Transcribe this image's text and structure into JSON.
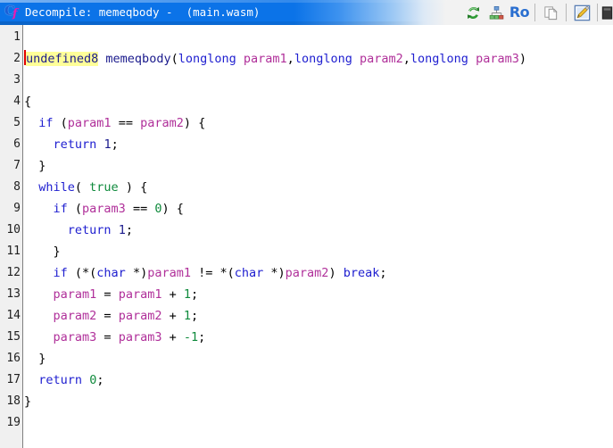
{
  "window": {
    "title": "Decompile: memeqbody -  (main.wasm)",
    "app_icon_letter": "C",
    "app_icon_sub": "f"
  },
  "toolbar": {
    "items": [
      {
        "name": "refresh-decompile-icon",
        "label": ""
      },
      {
        "name": "function-graph-icon",
        "label": ""
      },
      {
        "name": "ro-toggle-icon",
        "label": "Ro"
      },
      {
        "name": "copy-icon",
        "label": ""
      },
      {
        "name": "edit-icon",
        "label": ""
      },
      {
        "name": "overflow-icon",
        "label": ""
      }
    ],
    "ro_label": "Ro"
  },
  "editor": {
    "line_numbers": [
      "1",
      "2",
      "3",
      "4",
      "5",
      "6",
      "7",
      "8",
      "9",
      "10",
      "11",
      "12",
      "13",
      "14",
      "15",
      "16",
      "17",
      "18",
      "19"
    ],
    "highlighted_token": "undefined8",
    "caret_line": 2,
    "lines": [
      {
        "num": "1",
        "text": ""
      },
      {
        "num": "2",
        "text": "undefined8 memeqbody(longlong param1,longlong param2,longlong param3)"
      },
      {
        "num": "3",
        "text": ""
      },
      {
        "num": "4",
        "text": "{"
      },
      {
        "num": "5",
        "text": "  if (param1 == param2) {"
      },
      {
        "num": "6",
        "text": "    return 1;"
      },
      {
        "num": "7",
        "text": "  }"
      },
      {
        "num": "8",
        "text": "  while( true ) {"
      },
      {
        "num": "9",
        "text": "    if (param3 == 0) {"
      },
      {
        "num": "10",
        "text": "      return 1;"
      },
      {
        "num": "11",
        "text": "    }"
      },
      {
        "num": "12",
        "text": "    if (*(char *)param1 != *(char *)param2) break;"
      },
      {
        "num": "13",
        "text": "    param1 = param1 + 1;"
      },
      {
        "num": "14",
        "text": "    param2 = param2 + 1;"
      },
      {
        "num": "15",
        "text": "    param3 = param3 + -1;"
      },
      {
        "num": "16",
        "text": "  }"
      },
      {
        "num": "17",
        "text": "  return 0;"
      },
      {
        "num": "18",
        "text": "}"
      },
      {
        "num": "19",
        "text": ""
      }
    ],
    "tokens": {
      "l2_type": "undefined8",
      "l2_space1": " ",
      "l2_fn": "memeqbody",
      "l2_open": "(",
      "l2_t1": "longlong",
      "l2_p1": "param1",
      "l2_comma1": ",",
      "l2_t2": "longlong",
      "l2_p2": "param2",
      "l2_comma2": ",",
      "l2_t3": "longlong",
      "l2_p3": "param3",
      "l2_close": ")",
      "l4_brace": "{",
      "l5_indent": "  ",
      "l5_if": "if",
      "l5_open": " (",
      "l5_p1": "param1",
      "l5_eq": " == ",
      "l5_p2": "param2",
      "l5_close": ") {",
      "l6_indent": "    ",
      "l6_return": "return",
      "l6_sp": " ",
      "l6_one": "1",
      "l6_semi": ";",
      "l7": "  }",
      "l8_indent": "  ",
      "l8_while": "while",
      "l8_open": "( ",
      "l8_true": "true",
      "l8_close": " ) {",
      "l9_indent": "    ",
      "l9_if": "if",
      "l9_open": " (",
      "l9_p3": "param3",
      "l9_eq": " == ",
      "l9_zero": "0",
      "l9_close": ") {",
      "l10_indent": "      ",
      "l10_return": "return",
      "l10_sp": " ",
      "l10_one": "1",
      "l10_semi": ";",
      "l11": "    }",
      "l12_indent": "    ",
      "l12_if": "if",
      "l12_a": " (*(",
      "l12_char1": "char",
      "l12_b": " *)",
      "l12_p1": "param1",
      "l12_ne": " != ",
      "l12_c": "*(",
      "l12_char2": "char",
      "l12_d": " *)",
      "l12_p2": "param2",
      "l12_e": ") ",
      "l12_break": "break",
      "l12_semi": ";",
      "l13_indent": "    ",
      "l13_p1": "param1",
      "l13_assign": " = ",
      "l13_p1b": "param1",
      "l13_plus": " + ",
      "l13_one": "1",
      "l13_semi": ";",
      "l14_indent": "    ",
      "l14_p2": "param2",
      "l14_assign": " = ",
      "l14_p2b": "param2",
      "l14_plus": " + ",
      "l14_one": "1",
      "l14_semi": ";",
      "l15_indent": "    ",
      "l15_p3": "param3",
      "l15_assign": " = ",
      "l15_p3b": "param3",
      "l15_plus": " + ",
      "l15_negone": "-1",
      "l15_semi": ";",
      "l16": "  }",
      "l17_indent": "  ",
      "l17_return": "return",
      "l17_sp": " ",
      "l17_zero": "0",
      "l17_semi": ";",
      "l18_brace": "}"
    }
  },
  "colors": {
    "titlebar_blue": "#0b73e8",
    "gutter_bg": "#f0f0f0",
    "highlight_yellow": "#ffff99",
    "caret_red": "#e00000",
    "keyword_blue": "#2020d0",
    "variable_magenta": "#b0309a",
    "constant_green": "#0f8a3c",
    "function_navy": "#1a1a8c"
  }
}
